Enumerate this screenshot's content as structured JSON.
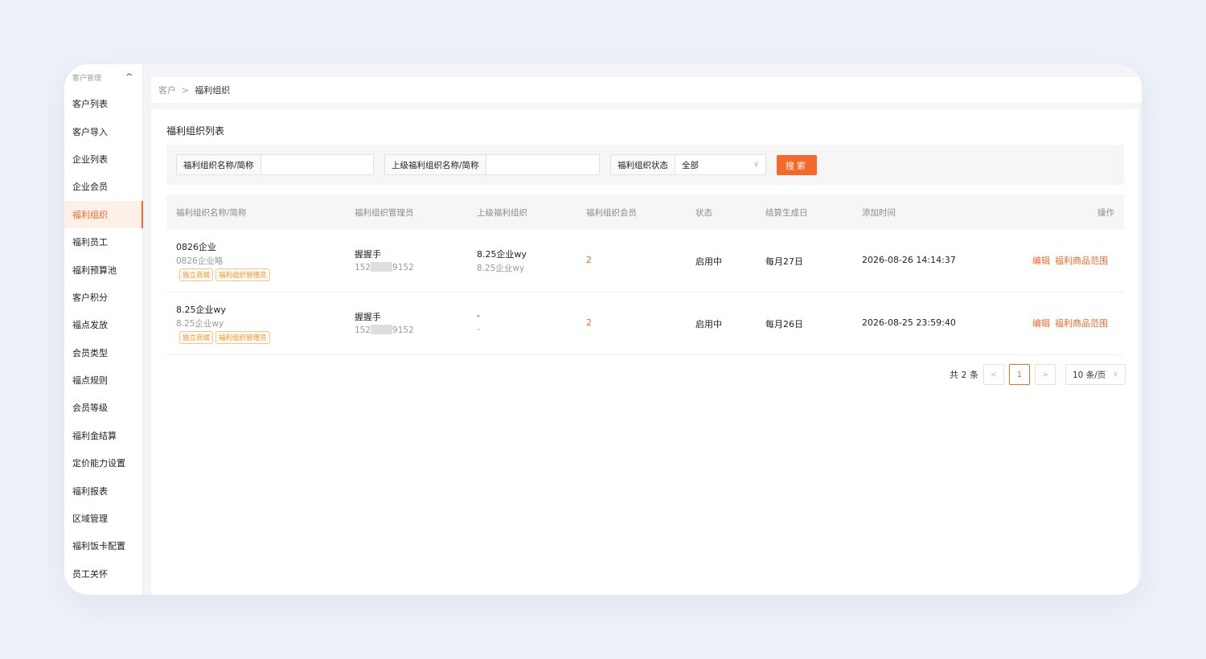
{
  "sidebar": {
    "header": "客户管理",
    "items": [
      {
        "label": "客户列表"
      },
      {
        "label": "客户导入"
      },
      {
        "label": "企业列表"
      },
      {
        "label": "企业会员"
      },
      {
        "label": "福利组织"
      },
      {
        "label": "福利员工"
      },
      {
        "label": "福利预算池"
      },
      {
        "label": "客户积分"
      },
      {
        "label": "福点发放"
      },
      {
        "label": "会员类型"
      },
      {
        "label": "福点规则"
      },
      {
        "label": "会员等级"
      },
      {
        "label": "福利金结算"
      },
      {
        "label": "定价能力设置"
      },
      {
        "label": "福利报表"
      },
      {
        "label": "区域管理"
      },
      {
        "label": "福利饭卡配置"
      },
      {
        "label": "员工关怀"
      }
    ],
    "active_index": 4
  },
  "breadcrumb": {
    "parent": "客户",
    "separator": ">",
    "current": "福利组织"
  },
  "page_title": "福利组织列表",
  "filters": {
    "name_label": "福利组织名称/简称",
    "name_value": "",
    "parent_label": "上级福利组织名称/简称",
    "parent_value": "",
    "status_label": "福利组织状态",
    "status_value": "全部",
    "search_button": "搜索"
  },
  "table": {
    "columns": [
      "福利组织名称/简称",
      "福利组织管理员",
      "上级福利组织",
      "福利组织会员",
      "状态",
      "结算生成日",
      "添加时间",
      "操作"
    ],
    "rows": [
      {
        "name": "0826企业",
        "short": "0826企业略",
        "tags": [
          "独立商城",
          "福利组织管理员"
        ],
        "admin": "握握手",
        "phone_prefix": "152",
        "phone_suffix": "9152",
        "parent": "8.25企业wy",
        "parent_short": "8.25企业wy",
        "members": "2",
        "status": "启用中",
        "settle_day": "每月27日",
        "added": "2026-08-26 14:14:37",
        "action_edit": "编辑",
        "action_scope": "福利商品范围"
      },
      {
        "name": "8.25企业wy",
        "short": "8.25企业wy",
        "tags": [
          "独立商城",
          "福利组织管理员"
        ],
        "admin": "握握手",
        "phone_prefix": "152",
        "phone_suffix": "9152",
        "parent": "-",
        "parent_short": "-",
        "members": "2",
        "status": "启用中",
        "settle_day": "每月26日",
        "added": "2026-08-25 23:59:40",
        "action_edit": "编辑",
        "action_scope": "福利商品范围"
      }
    ]
  },
  "pagination": {
    "total": "共 2 条",
    "prev": "<",
    "current": "1",
    "next": ">",
    "page_size": "10 条/页"
  },
  "colors": {
    "accent": "#f2692a",
    "tag": "#f2962a",
    "background": "#edf1f8"
  }
}
